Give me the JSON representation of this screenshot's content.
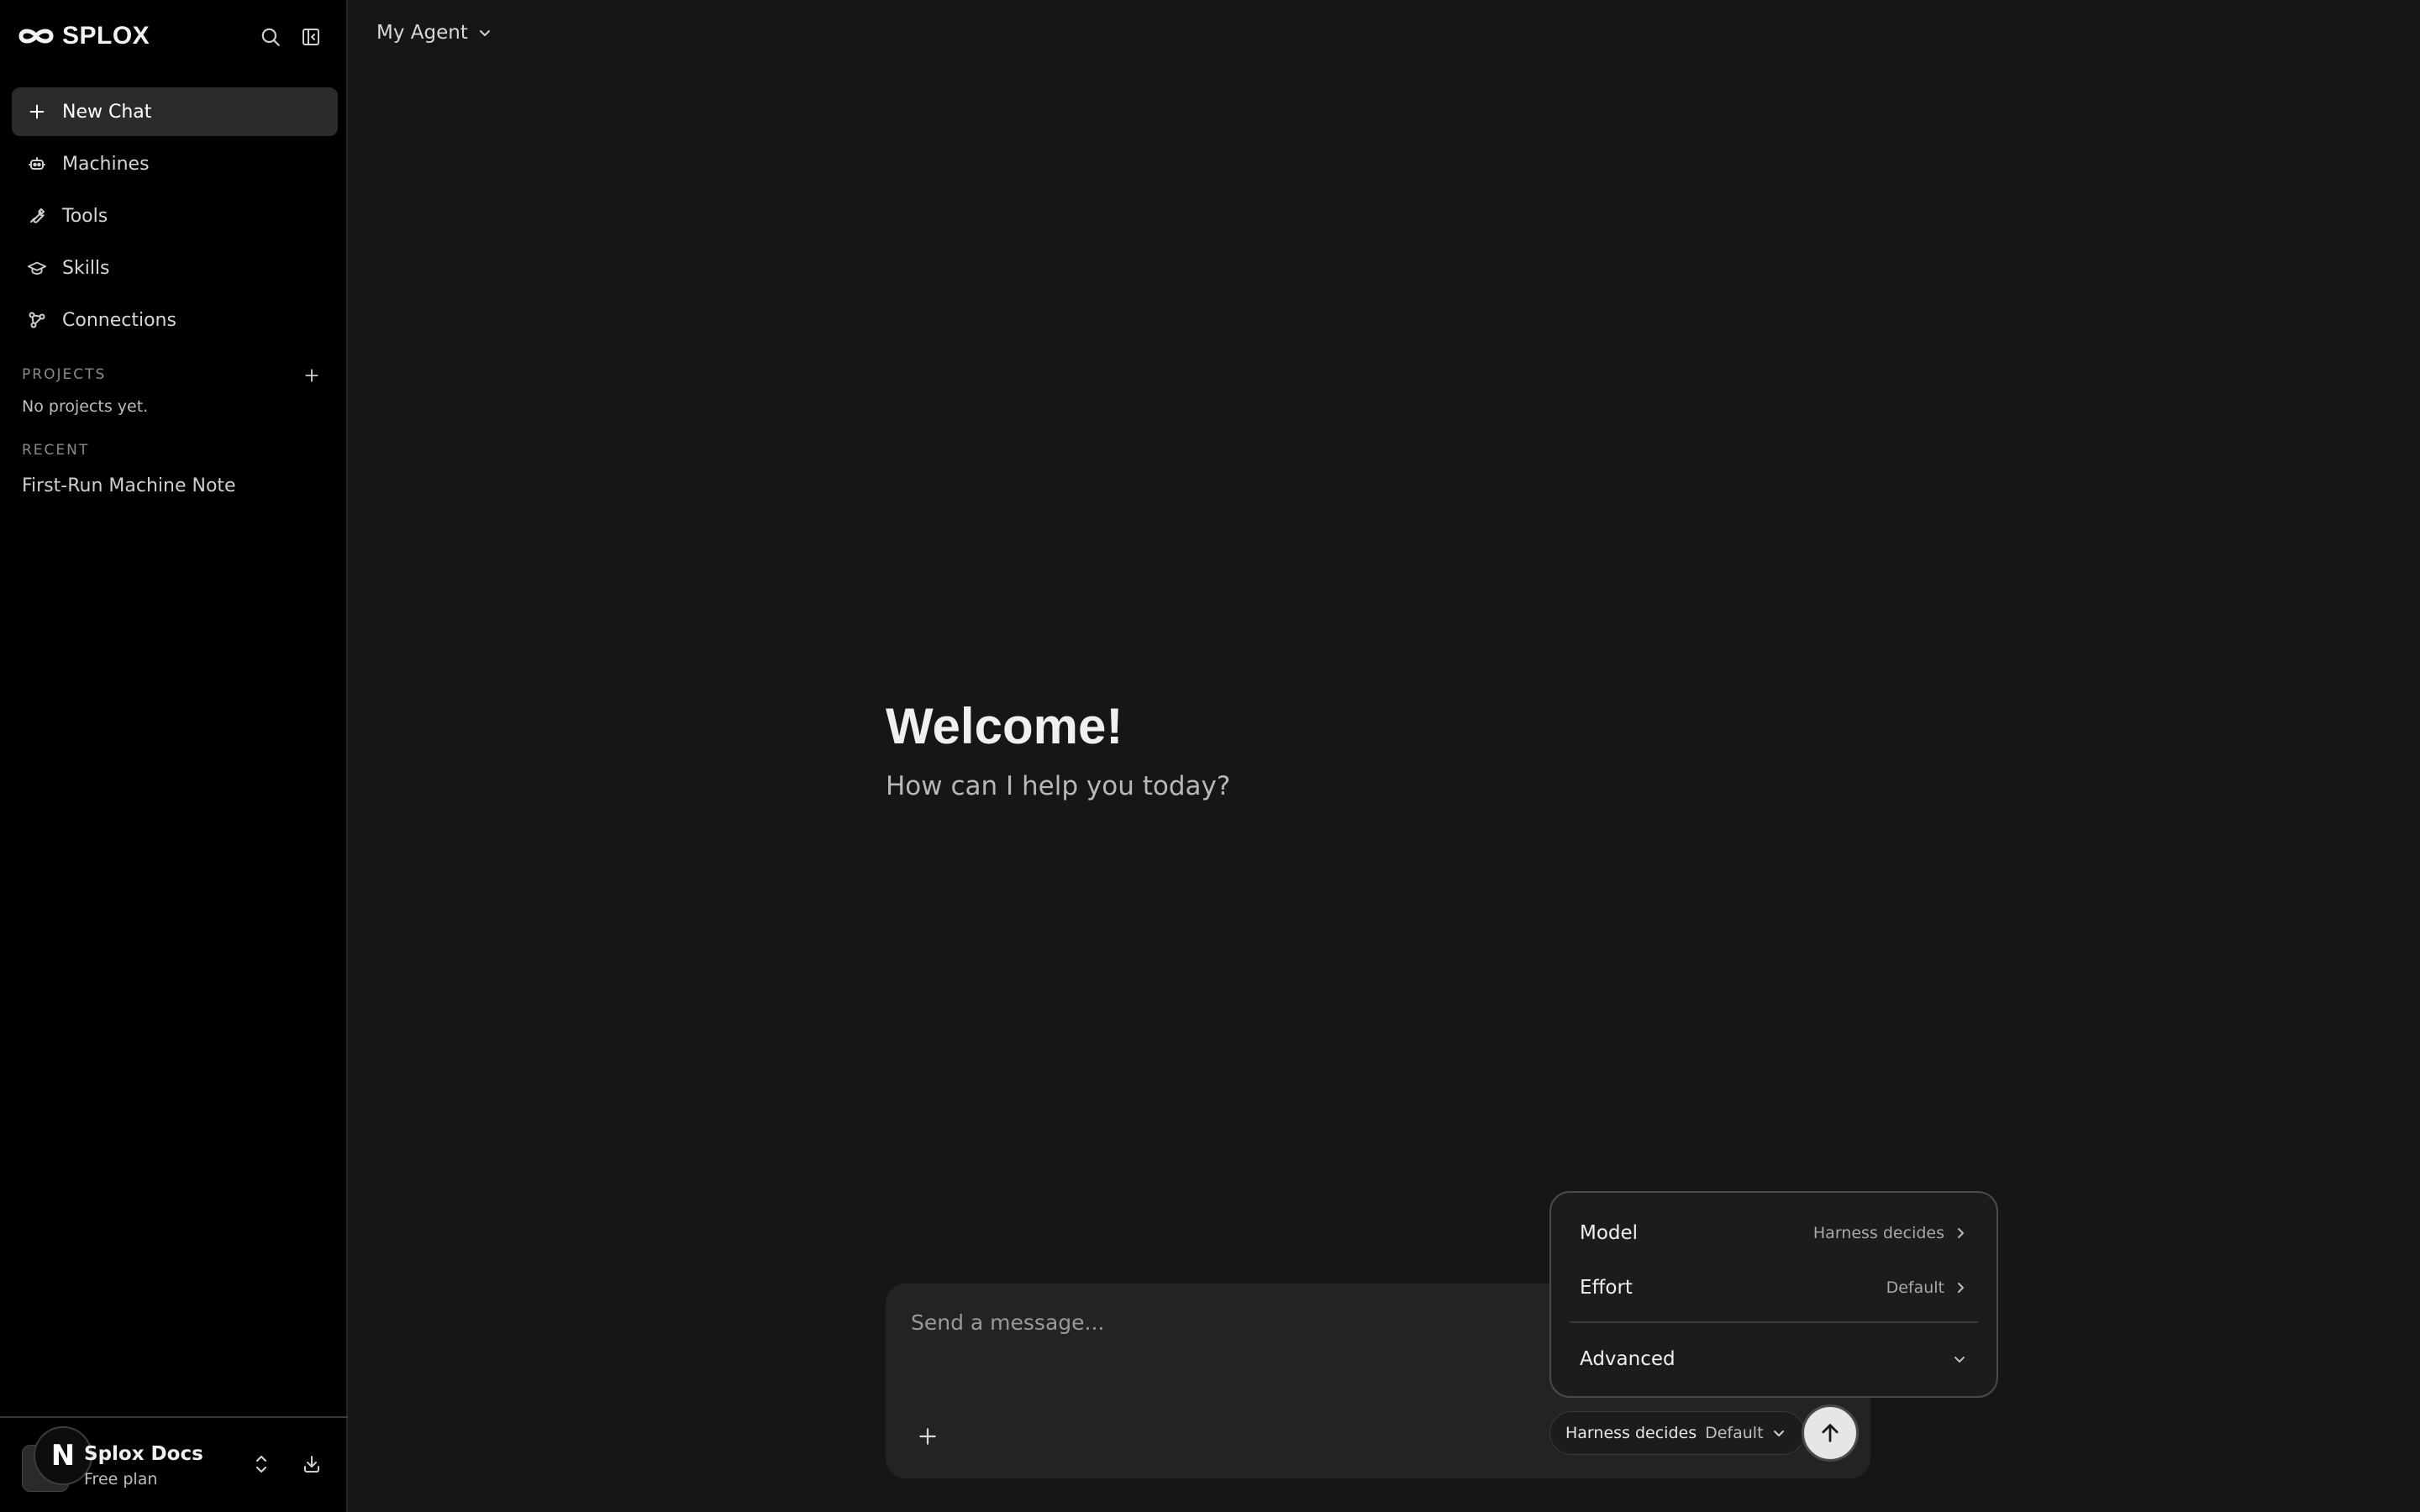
{
  "app": {
    "name": "SPLOX"
  },
  "sidebar": {
    "nav": [
      {
        "label": "New Chat",
        "icon": "plus-icon",
        "active": true
      },
      {
        "label": "Machines",
        "icon": "robot-icon"
      },
      {
        "label": "Tools",
        "icon": "wrench-icon"
      },
      {
        "label": "Skills",
        "icon": "graduation-cap-icon"
      },
      {
        "label": "Connections",
        "icon": "nodes-icon"
      }
    ],
    "projects": {
      "title": "PROJECTS",
      "empty_text": "No projects yet."
    },
    "recent": {
      "title": "RECENT",
      "items": [
        "First-Run Machine Note"
      ]
    },
    "workspace": {
      "avatar_letter": "N",
      "name": "Splox Docs",
      "plan": "Free plan"
    }
  },
  "header": {
    "agent_label": "My Agent"
  },
  "welcome": {
    "title": "Welcome!",
    "subtitle": "How can I help you today?"
  },
  "composer": {
    "placeholder": "Send a message...",
    "model_value": "Harness decides",
    "effort_value": "Default"
  },
  "dropdown": {
    "model": {
      "label": "Model",
      "value": "Harness decides"
    },
    "effort": {
      "label": "Effort",
      "value": "Default"
    },
    "advanced": {
      "label": "Advanced"
    }
  },
  "colors": {
    "sidebar_bg": "#000000",
    "main_bg": "#161616",
    "composer_bg": "#232323",
    "active_item_bg": "#2b2b2b",
    "send_button": "#e6e6e6"
  }
}
